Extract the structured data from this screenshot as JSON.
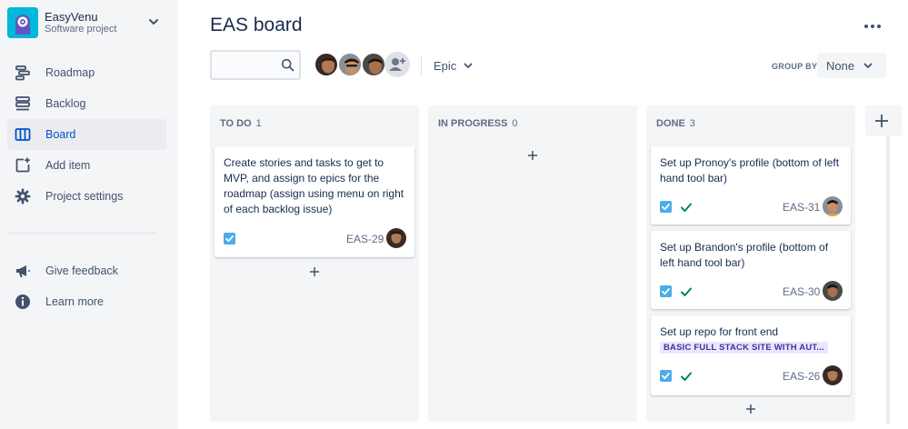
{
  "project": {
    "name": "EasyVenu",
    "type": "Software project",
    "logo": "project-logo-icon"
  },
  "nav": [
    {
      "label": "Roadmap",
      "icon": "roadmap-icon",
      "active": false
    },
    {
      "label": "Backlog",
      "icon": "backlog-icon",
      "active": false
    },
    {
      "label": "Board",
      "icon": "board-icon",
      "active": true
    },
    {
      "label": "Add item",
      "icon": "add-item-icon",
      "active": false
    },
    {
      "label": "Project settings",
      "icon": "gear-icon",
      "active": false
    }
  ],
  "nav_footer": [
    {
      "label": "Give feedback",
      "icon": "megaphone-icon"
    },
    {
      "label": "Learn more",
      "icon": "info-icon"
    }
  ],
  "board": {
    "title": "EAS board",
    "search_value": "",
    "epic_filter": "Epic",
    "group_by_label": "GROUP BY",
    "group_by_value": "None"
  },
  "columns": [
    {
      "name": "TO DO",
      "count": "1",
      "cards": [
        {
          "text": "Create stories and tasks to get to MVP, and assign to epics for the roadmap (assign using menu on right of each backlog issue)",
          "key": "EAS-29",
          "done": false,
          "epic": ""
        }
      ]
    },
    {
      "name": "IN PROGRESS",
      "count": "0",
      "cards": []
    },
    {
      "name": "DONE",
      "count": "3",
      "cards": [
        {
          "text": "Set up Pronoy's profile (bottom of left hand tool bar)",
          "key": "EAS-31",
          "done": true,
          "epic": ""
        },
        {
          "text": "Set up Brandon's profile (bottom of left hand tool bar)",
          "key": "EAS-30",
          "done": true,
          "epic": ""
        },
        {
          "text": "Set up repo for front end",
          "key": "EAS-26",
          "done": true,
          "epic": "BASIC FULL STACK SITE WITH AUT..."
        }
      ]
    }
  ],
  "colors": {
    "accent": "#0052cc",
    "story_check": "#4bade8",
    "done_check": "#00875a",
    "sidebar_bg": "#f4f5f7",
    "column_bg": "#f4f5f7",
    "epic_lozenge_bg": "#eae6ff",
    "epic_lozenge_text": "#403294"
  }
}
